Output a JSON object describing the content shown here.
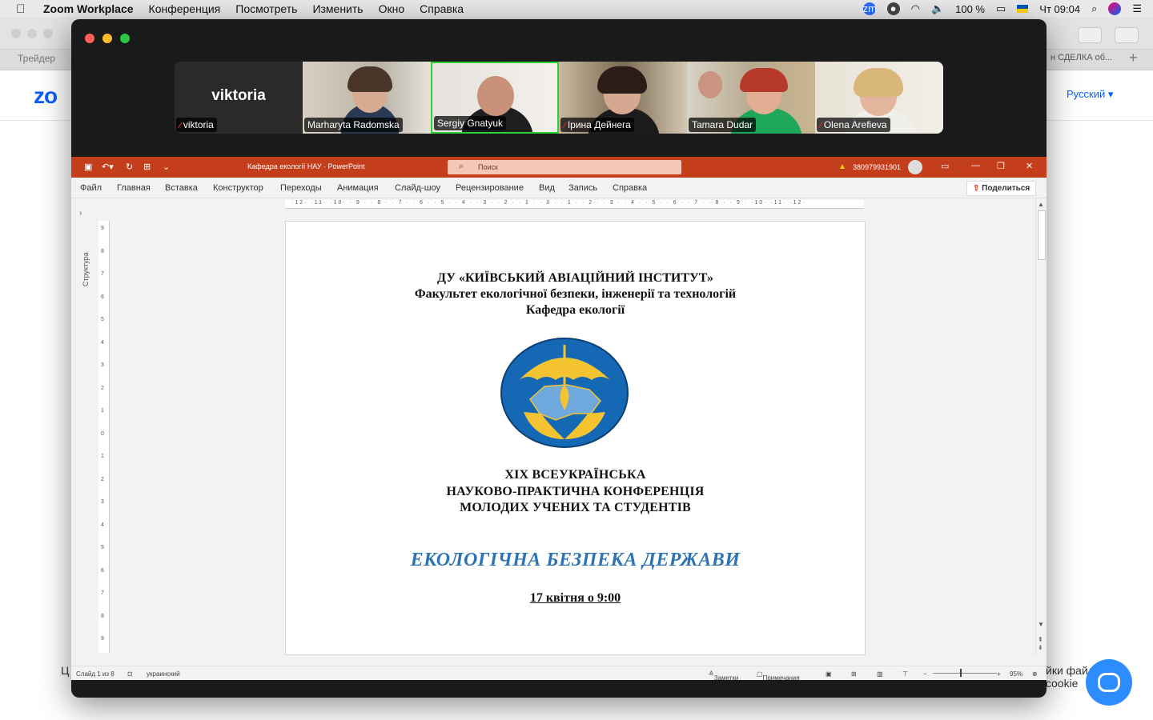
{
  "menubar": {
    "app": "Zoom Workplace",
    "items": [
      "Конференция",
      "Посмотреть",
      "Изменить",
      "Окно",
      "Справка"
    ],
    "battery": "100 %",
    "clock": "Чт 09:04"
  },
  "browser": {
    "tab_left": "Трейдер",
    "tab_right": "н СДЕЛКА об...",
    "logo": "zo",
    "language": "Русский",
    "cookie_line1": "йки файл",
    "cookie_line2": "cookie",
    "footer_left": "Ц"
  },
  "participants": [
    {
      "name": "viktoria",
      "big": "viktoria",
      "muted": true,
      "active": false
    },
    {
      "name": "Marharyta Radomska",
      "muted": false,
      "active": false
    },
    {
      "name": "Sergiy Gnatyuk",
      "muted": false,
      "active": true
    },
    {
      "name": "Ірина Дейнега",
      "muted": true,
      "active": false
    },
    {
      "name": "Tamara Dudar",
      "muted": false,
      "active": false
    },
    {
      "name": "Olena Arefieva",
      "muted": true,
      "active": false
    }
  ],
  "ppt": {
    "doc_title": "Кафедра екології НАУ  ·  PowerPoint",
    "search": "Поиск",
    "account": "380979931901",
    "ribbon": [
      "Файл",
      "Главная",
      "Вставка",
      "Конструктор",
      "Переходы",
      "Анимация",
      "Слайд-шоу",
      "Рецензирование",
      "Вид",
      "Запись",
      "Справка"
    ],
    "share": "Поделиться",
    "outline_label": "Структура",
    "ruler_h": "·12· ·11· ·10· · 9 · · 8 · · 7 · · 6 · · 5 · · 4 · · 3 · · 2 · · 1 · · 0 · · 1 · · 2 · · 3 · · 4 · · 5 · · 6 · · 7 · · 8 · · 9 · ·10· ·11· ·12·",
    "status": {
      "slide": "Слайд 1 из 8",
      "language": "украинский",
      "notes": "Заметки",
      "comments": "Примечания",
      "zoom": "95%"
    }
  },
  "slide": {
    "line1": "ДУ «КИЇВСЬКИЙ АВІАЦІЙНИЙ ІНСТИТУТ»",
    "line2": "Факультет екологічної безпеки, інженерії та технологій",
    "line3": "Кафедра екології",
    "conf1": "XIX ВСЕУКРАЇНСЬКА",
    "conf2": "НАУКОВО-ПРАКТИЧНА КОНФЕРЕНЦІЯ",
    "conf3": "МОЛОДИХ УЧЕНИХ ТА СТУДЕНТІВ",
    "topic": "ЕКОЛОГІЧНА БЕЗПЕКА ДЕРЖАВИ",
    "date": "17 квітня о 9:00"
  },
  "colors": {
    "ppt_accent": "#c43e1c",
    "active_speaker": "#2dd134",
    "topic_blue": "#2e74b5",
    "zoom_blue": "#0b5cff"
  }
}
